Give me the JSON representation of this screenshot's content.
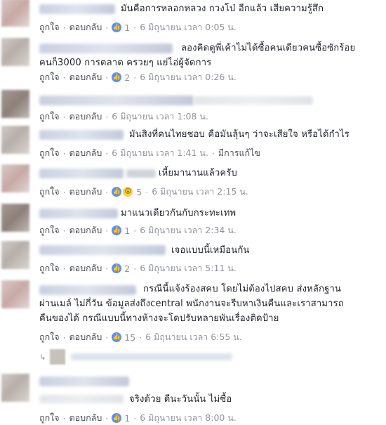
{
  "ui": {
    "like_label": "ถูกใจ",
    "reply_label": "ตอบกลับ",
    "like_icon": "thumbs-up-icon",
    "wow_icon": "wow-reaction-icon",
    "colors": {
      "link": "#4b4f56",
      "meta": "#90949c",
      "like_blue": "#5890ff",
      "text": "#1d2129"
    }
  },
  "comments": [
    {
      "text": "มันคือการหลอกหลวง กวงโบ๋ อีกแล้ว เสียความรู้สึก",
      "likes": "1",
      "time": "6 มิถุนายน เวลา 0:05 น."
    },
    {
      "text": "ลองคิดดูพี่เค้าไม่ได้ซื้อคนเดียวคนซื้อซักร้อย\nคนก็3000 การตลาด ครวยๆ แย่ไอ่ผู้จัดการ",
      "likes": "2",
      "time": "6 มิถุนายน เวลา 0:26 น."
    },
    {
      "text": "",
      "time": "6 มิถุนายน เวลา 1:08 น."
    },
    {
      "text": "มันสิงที่คนไทยชอบ คือมันลุ้นๆ ว่าจะเสียใจ หรือได้กำไร",
      "time": "6 มิถุนายน เวลา 1:41 น.",
      "edited": "มีการแก้ไข"
    },
    {
      "text": "เหี้ยมานานแล้วครับ",
      "likes": "5",
      "time": "6 มิถุนายน เวลา 2:15 น."
    },
    {
      "text": "มาแนวเดียวกันกับกระทะเทพ",
      "likes": "1",
      "time": "6 มิถุนายน เวลา 2:34 น."
    },
    {
      "text": "เจอแบบนี้เหมือนกัน",
      "likes": "2",
      "time": "6 มิถุนายน เวลา 5:11 น."
    },
    {
      "text": "กรณีนี้แจ้งร้องสคบ โดยไม่ต้องไปสคบ ส่งหลักฐาน\nผ่านเมล์ ไม่กี่วัน ข้อมูลส่งถึงcentral พนักงานจะรีบหาเงินคืนและเราสามารถ\nคืนของได้ กรณีแบบนี้ทางห้างจะโดปรับหลายพันเรื่องติดป้าย",
      "likes": "15",
      "time": "6 มิถุนายน เวลา 6:55 น."
    },
    {
      "text": "จริงด้วย ดีนะวันนั้น ไม่ซื้อ",
      "likes": "1",
      "time": "6 มิถุนายน เวลา 8:00 น."
    }
  ]
}
